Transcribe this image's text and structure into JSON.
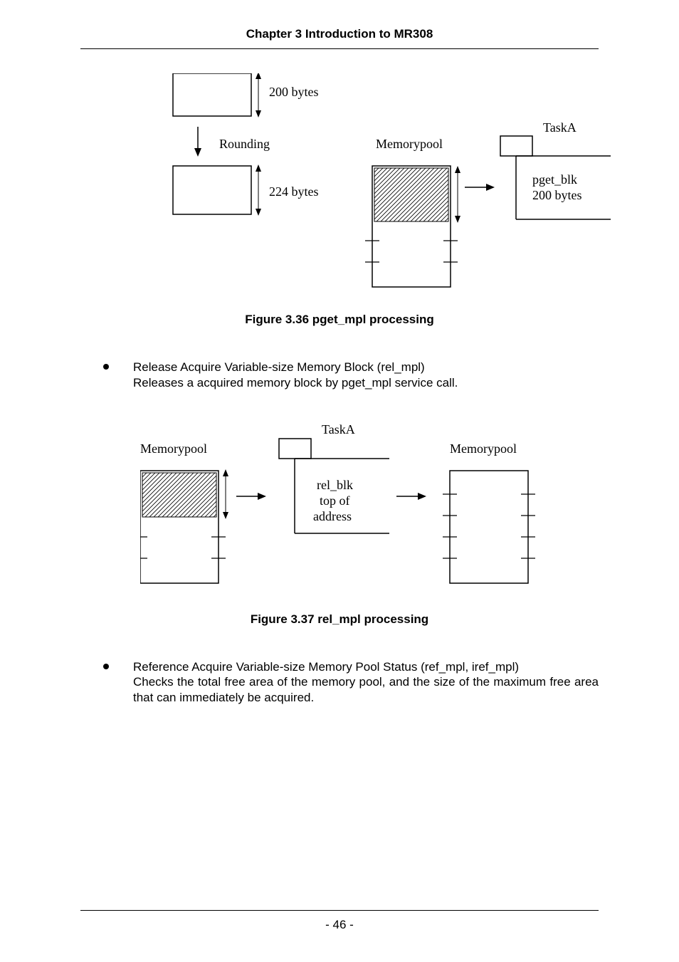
{
  "header": {
    "chapter_title": "Chapter 3 Introduction to MR308"
  },
  "figure36": {
    "caption": "Figure 3.36 pget_mpl processing",
    "labels": {
      "bytes200": "200 bytes",
      "rounding": "Rounding",
      "bytes224": "224 bytes",
      "memorypool": "Memorypool",
      "taskA": "TaskA",
      "pget_blk": "pget_blk",
      "pget_blk_bytes": "200 bytes"
    }
  },
  "bullet1": {
    "title": "Release Acquire Variable-size Memory Block (rel_mpl)",
    "desc": "Releases a acquired memory block by pget_mpl service call."
  },
  "figure37": {
    "caption": "Figure 3.37 rel_mpl processing",
    "labels": {
      "memorypool_left": "Memorypool",
      "taskA": "TaskA",
      "rel_blk": "rel_blk",
      "top_of": "top of",
      "address": "address",
      "memorypool_right": "Memorypool"
    }
  },
  "bullet2": {
    "title": "Reference Acquire Variable-size Memory Pool Status (ref_mpl, iref_mpl)",
    "desc": "Checks the total free area of the memory pool, and the size of the maximum free area that can immediately be acquired."
  },
  "footer": {
    "page_number": "- 46 -"
  }
}
